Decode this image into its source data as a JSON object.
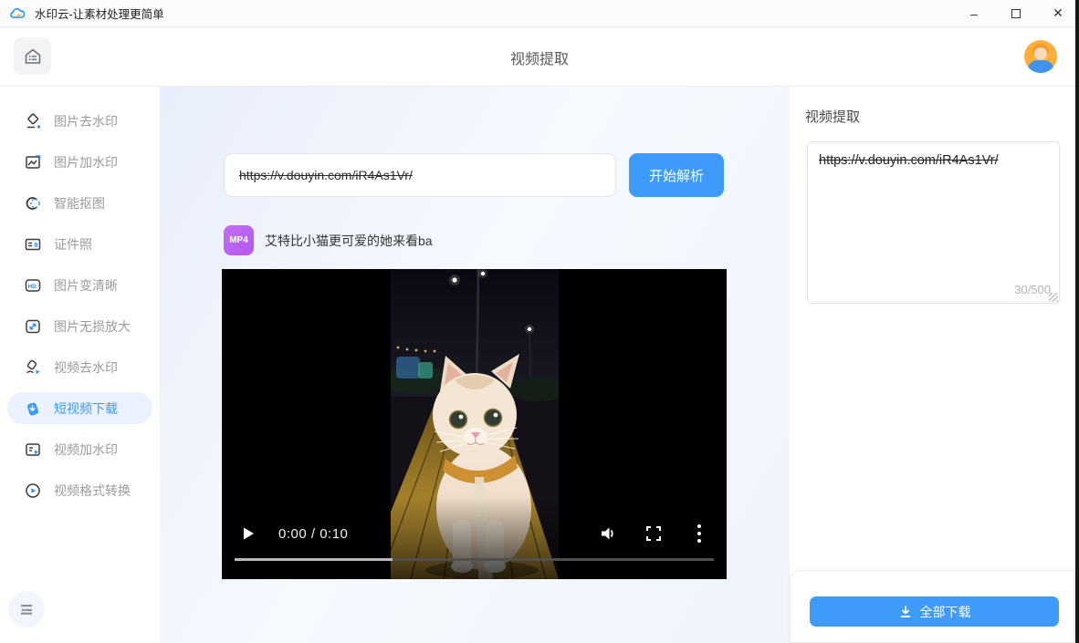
{
  "window": {
    "app_title": "水印云-让素材处理更简单",
    "minimize_glyph": "–",
    "close_glyph": "✕"
  },
  "header": {
    "title": "视频提取"
  },
  "sidebar": {
    "items": [
      {
        "label": "图片去水印"
      },
      {
        "label": "图片加水印"
      },
      {
        "label": "智能抠图"
      },
      {
        "label": "证件照"
      },
      {
        "label": "图片变清晰"
      },
      {
        "label": "图片无损放大"
      },
      {
        "label": "视频去水印"
      },
      {
        "label": "短视频下载",
        "selected": true
      },
      {
        "label": "视频加水印"
      },
      {
        "label": "视频格式转换"
      }
    ]
  },
  "main": {
    "url_input_value": "https://v.douyin.com/iR4As1Vr/",
    "parse_button_label": "开始解析",
    "result": {
      "badge": "MP4",
      "title": "艾特比小猫更可爱的她来看ba"
    },
    "player": {
      "time": "0:00 / 0:10",
      "progress_percent": 33
    }
  },
  "right_panel": {
    "title": "视频提取",
    "textarea_value": "https://v.douyin.com/iR4As1Vr/",
    "char_count": "30/500",
    "download_all_label": "全部下载"
  },
  "colors": {
    "accent_blue": "#3e9bfa",
    "selected_item_bg": "#e9f2fe",
    "mp4_badge_purple": "#b85cf0",
    "avatar_bg": "#ffaf38"
  }
}
